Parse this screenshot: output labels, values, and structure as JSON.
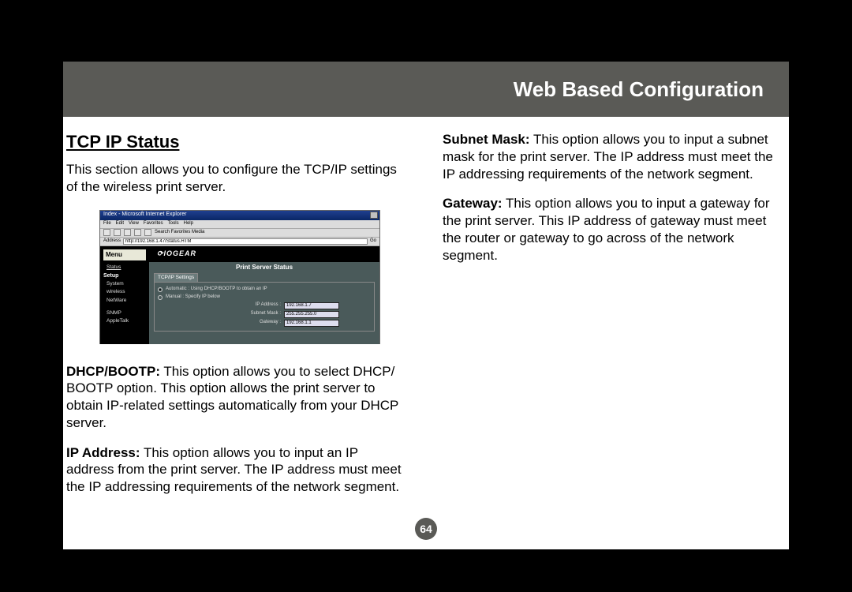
{
  "header": {
    "title": "Web Based Configuration"
  },
  "page_number": "64",
  "left": {
    "section_title": "TCP IP Status",
    "intro": "This section allows you to configure the TCP/IP settings of the wireless print server.",
    "dhcp_label": "DHCP/BOOTP:",
    "dhcp_text": " This option allows you to select DHCP/ BOOTP option. This option allows the print server to obtain IP-related settings automatically from your DHCP server.",
    "ip_label": "IP Address:",
    "ip_text": " This option allows you to input an IP address from the print server. The IP address must meet the IP addressing requirements of the network segment."
  },
  "right": {
    "subnet_label": "Subnet Mask:",
    "subnet_text": " This option allows you to input a subnet mask for the print server. The IP address must meet the IP addressing requirements of the network segment.",
    "gateway_label": "Gateway:",
    "gateway_text": " This option allows you to input a gateway for the print server. This IP address of gateway must meet the router or gateway to go across of the network segment."
  },
  "screenshot": {
    "window_title": "Index - Microsoft Internet Explorer",
    "menubar": [
      "File",
      "Edit",
      "View",
      "Favorites",
      "Tools",
      "Help"
    ],
    "toolbar_text": "Search  Favorites  Media",
    "address_label": "Address",
    "address_value": "http://192.168.1.47/Status.HTM",
    "go_label": "Go",
    "sidebar": {
      "menu_heading": "Menu",
      "status_link": "Status",
      "setup_heading": "Setup",
      "items_a": [
        "System",
        "wireless",
        "NetWare"
      ],
      "items_b": [
        "SNMP",
        "AppleTalk"
      ]
    },
    "brand": "IOGEAR",
    "panel_title": "Print Server Status",
    "tab": "TCP/IP Settings",
    "opt_auto": "Automatic : Using DHCP/BOOTP to obtain an IP",
    "opt_manual": "Manual : Specify IP below",
    "ip_label": "IP Address :",
    "ip_value": "192.168.1.7",
    "mask_label": "Subnet Mask :",
    "mask_value": "255.255.255.0",
    "gw_label": "Gateway :",
    "gw_value": "192.168.1.1"
  }
}
